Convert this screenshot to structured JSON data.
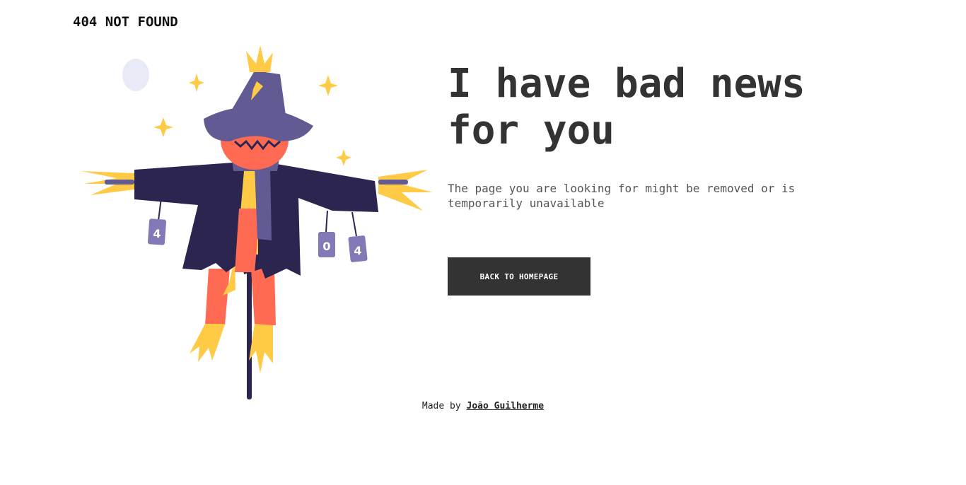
{
  "header": {
    "brand": "404 NOT FOUND"
  },
  "main": {
    "headline_line1": "I have bad news",
    "headline_line2": "for you",
    "description": "The page you are looking for might be removed or is temporarily unavailable",
    "cta_label": "BACK TO HOMEPAGE"
  },
  "illustration": {
    "can_labels": [
      "4",
      "0",
      "4"
    ],
    "colors": {
      "hat": "#625A92",
      "coat": "#2B2550",
      "face": "#FF6B52",
      "straw": "#FFCB47",
      "scarf": "#625A92",
      "moon": "#E8EBF5"
    }
  },
  "footer": {
    "made_by_prefix": "Made by",
    "author": "João Guilherme"
  }
}
